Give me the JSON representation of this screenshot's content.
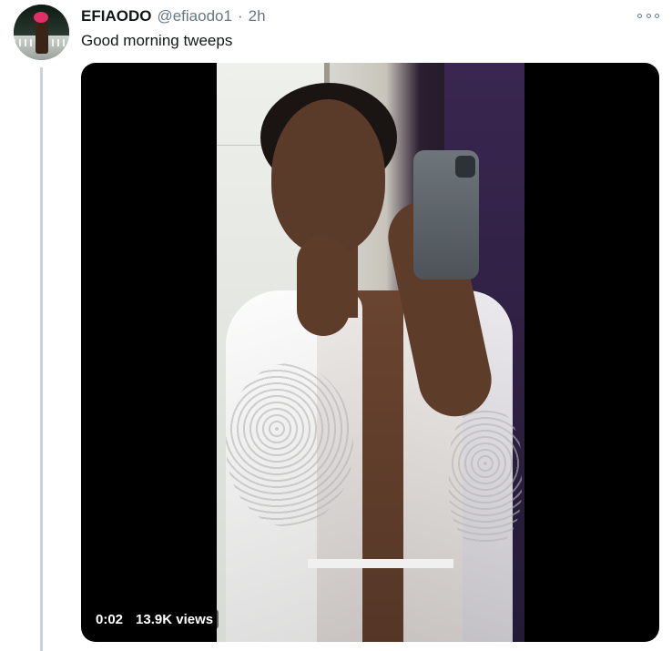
{
  "tweet": {
    "author_name": "EFIAODO",
    "author_handle": "@efiaodo1",
    "separator": "·",
    "time": "2h",
    "text": "Good morning tweeps",
    "more_icon": "more-horizontal-icon"
  },
  "video": {
    "elapsed": "0:02",
    "views": "13.9K views"
  },
  "colors": {
    "text_primary": "#14171a",
    "text_secondary": "#657786",
    "thread_line": "#c8d2da",
    "media_background": "#000000"
  }
}
